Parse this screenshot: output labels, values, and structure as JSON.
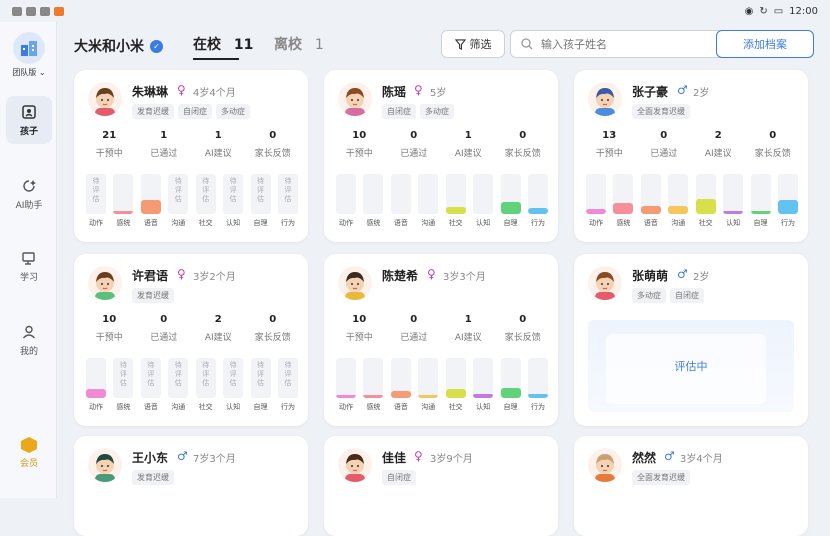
{
  "status_bar": {
    "time": "12:00"
  },
  "sidebar": {
    "team_label": "团队版",
    "items": [
      {
        "label": "孩子",
        "active": true
      },
      {
        "label": "AI助手",
        "active": false
      },
      {
        "label": "学习",
        "active": false
      },
      {
        "label": "我的",
        "active": false
      }
    ],
    "member_label": "会员"
  },
  "header": {
    "org_name": "大米和小米",
    "tab_in_school": "在校",
    "tab_in_school_count": "11",
    "tab_left_school": "离校",
    "tab_left_school_count": "1",
    "filter_label": "筛选",
    "search_placeholder": "输入孩子姓名",
    "add_button": "添加档案"
  },
  "stat_labels": [
    "干预中",
    "已通过",
    "AI建议",
    "家长反馈"
  ],
  "domain_labels": [
    "动作",
    "感统",
    "语音",
    "沟通",
    "社交",
    "认知",
    "自理",
    "行为"
  ],
  "pending_text": "待评估",
  "evaluating_text": "评估中",
  "colors": {
    "accent": "#3b7be3",
    "female": "#c040b0",
    "male": "#3b7be3",
    "domains": [
      "#f08ad8",
      "#f5909a",
      "#f59a72",
      "#f5c65a",
      "#d7e04a",
      "#c07ae0",
      "#5fd27a",
      "#63c3f0"
    ]
  },
  "children": [
    {
      "name": "朱琳琳",
      "gender": "♀",
      "age": "4岁4个月",
      "tags": [
        "发育迟缓",
        "自闭症",
        "多动症"
      ],
      "stats": [
        "21",
        "1",
        "1",
        "0"
      ],
      "bars": [
        null,
        0.08,
        0.35,
        null,
        null,
        null,
        null,
        null
      ]
    },
    {
      "name": "陈瑶",
      "gender": "♀",
      "age": "5岁",
      "tags": [
        "自闭症",
        "多动症"
      ],
      "stats": [
        "10",
        "0",
        "1",
        "0"
      ],
      "bars": [
        0,
        0,
        0,
        0,
        0.18,
        0,
        0.3,
        0.15
      ]
    },
    {
      "name": "张子豪",
      "gender": "♂",
      "age": "2岁",
      "tags": [
        "全面发育迟缓"
      ],
      "stats": [
        "13",
        "0",
        "2",
        "0"
      ],
      "bars": [
        0.12,
        0.28,
        0.2,
        0.2,
        0.38,
        0.08,
        0.05,
        0.35
      ]
    },
    {
      "name": "许君语",
      "gender": "♀",
      "age": "3岁2个月",
      "tags": [
        "发育迟缓"
      ],
      "stats": [
        "10",
        "0",
        "2",
        "0"
      ],
      "bars": [
        0.22,
        null,
        null,
        null,
        null,
        null,
        null,
        null
      ]
    },
    {
      "name": "陈楚希",
      "gender": "♀",
      "age": "3岁3个月",
      "tags": [],
      "stats": [
        "10",
        "0",
        "1",
        "0"
      ],
      "bars": [
        0.06,
        0.06,
        0.18,
        0.05,
        0.22,
        0.1,
        0.25,
        0.1
      ]
    },
    {
      "name": "张萌萌",
      "gender": "♂",
      "age": "2岁",
      "tags": [
        "多动症",
        "自闭症"
      ],
      "evaluating": true
    },
    {
      "name": "王小东",
      "gender": "♂",
      "age": "7岁3个月",
      "tags": [
        "发育迟缓"
      ]
    },
    {
      "name": "佳佳",
      "gender": "♀",
      "age": "3岁9个月",
      "tags": [
        "自闭症"
      ]
    },
    {
      "name": "然然",
      "gender": "♂",
      "age": "3岁4个月",
      "tags": [
        "全面发育迟缓"
      ]
    }
  ]
}
